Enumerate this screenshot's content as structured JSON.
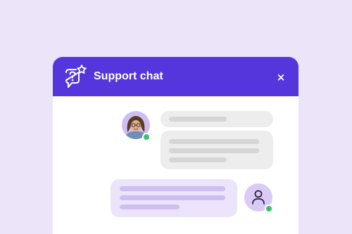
{
  "header": {
    "title": "Support chat",
    "close_label": "×",
    "icon": "chat-question-sparkle-icon"
  },
  "colors": {
    "page_background": "#ece4f9",
    "header": "#5536dc",
    "agent_bubble": "#ededed",
    "user_bubble": "#ece4fb",
    "online_status": "#3fbf6f"
  },
  "messages": [
    {
      "sender": "agent",
      "content": "placeholder-lines"
    },
    {
      "sender": "agent",
      "content": "placeholder-lines"
    },
    {
      "sender": "user",
      "content": "placeholder-lines"
    }
  ],
  "participants": {
    "agent": {
      "avatar": "agent-photo-avatar",
      "status": "online"
    },
    "user": {
      "avatar": "person-icon",
      "status": "online"
    }
  }
}
